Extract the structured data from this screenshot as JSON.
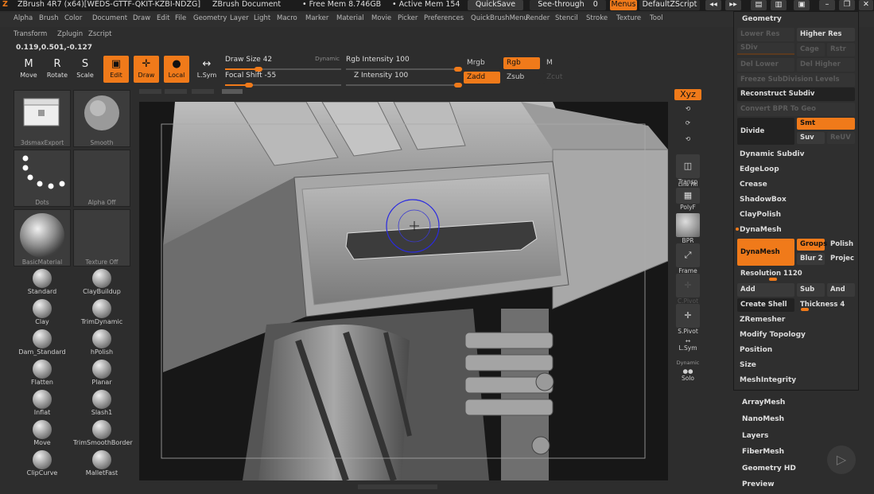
{
  "title_bar": {
    "app": "ZBrush 4R7 (x64)[WEDS-GTTF-QKIT-KZBI-NDZG]",
    "document": "ZBrush Document",
    "free_mem": "• Free Mem 8.746GB",
    "active_mem": "• Active Mem 154",
    "quicksave": "QuickSave",
    "see_through_label": "See-through",
    "see_through_value": "0",
    "menus": "Menus",
    "default_zscript": "DefaultZScript"
  },
  "menu_row1": [
    "Alpha",
    "Brush",
    "Color",
    "Document",
    "Draw",
    "Edit",
    "File",
    "Geometry",
    "Layer",
    "Light",
    "Macro",
    "Marker",
    "Material",
    "Movie",
    "Picker",
    "Preferences",
    "QuickBrushMenu",
    "Render",
    "Stencil",
    "Stroke",
    "Texture",
    "Tool"
  ],
  "menu_row2": [
    "Transform",
    "Zplugin",
    "Zscript"
  ],
  "coords": "0.119,0.501,-0.127",
  "tools": {
    "move": "Move",
    "rotate": "Rotate",
    "scale": "Scale",
    "edit": "Edit",
    "draw": "Draw",
    "local": "Local",
    "lsym": "L.Sym"
  },
  "sliders": {
    "draw_size_label": "Draw Size 42",
    "dynamic": "Dynamic",
    "focal_shift_label": "Focal Shift -55",
    "rgb_intensity_label": "Rgb Intensity 100",
    "z_intensity_label": "Z Intensity 100",
    "draw_size_fraction": 0.32,
    "focal_shift_fraction": 0.24,
    "rgb_intensity_fraction": 1.0,
    "z_intensity_fraction": 1.0
  },
  "color_modes": {
    "mrgb": "Mrgb",
    "rgb": "Rgb",
    "m": "M",
    "zadd": "Zadd",
    "zsub": "Zsub",
    "zcut": "Zcut"
  },
  "left_panel": {
    "thumbs": [
      "3dsmaxExport",
      "Smooth",
      "Dots",
      "Alpha Off",
      "BasicMaterial",
      "Texture Off"
    ],
    "brushes": [
      "Standard",
      "ClayBuildup",
      "Clay",
      "TrimDynamic",
      "Dam_Standard",
      "hPolish",
      "Flatten",
      "Planar",
      "Inflat",
      "Slash1",
      "Move",
      "TrimSmoothBorder",
      "ClipCurve",
      "MalletFast"
    ]
  },
  "right_strip": {
    "xyz": "Xyz",
    "transp": "Transp",
    "line_fill": "Line Fill",
    "polyf": "PolyF",
    "bpr": "BPR",
    "frame": "Frame",
    "cpivot": "C.Pivot",
    "spivot": "S.Pivot",
    "lsym": "L.Sym",
    "dynamic": "Dynamic",
    "solo": "Solo"
  },
  "geometry_panel": {
    "header": "Geometry",
    "lower_res": "Lower Res",
    "higher_res": "Higher Res",
    "sdiv": "SDiv",
    "cage": "Cage",
    "rstr": "Rstr",
    "del_lower": "Del Lower",
    "del_higher": "Del Higher",
    "freeze_subdivision": "Freeze SubDivision Levels",
    "reconstruct_subdiv": "Reconstruct Subdiv",
    "convert_bpr": "Convert BPR To Geo",
    "divide": "Divide",
    "smt": "Smt",
    "suv": "Suv",
    "reuv": "ReUV",
    "items": [
      "Dynamic Subdiv",
      "EdgeLoop",
      "Crease",
      "ShadowBox",
      "ClayPolish",
      "DynaMesh"
    ],
    "dynamesh_button": "DynaMesh",
    "groups": "Groups",
    "polish": "Polish",
    "blur": "Blur 2",
    "project": "Projec",
    "resolution_label": "Resolution 1120",
    "add": "Add",
    "sub": "Sub",
    "and": "And",
    "create_shell": "Create Shell",
    "thickness": "Thickness 4",
    "items2": [
      "ZRemesher",
      "Modify Topology",
      "Position",
      "Size",
      "MeshIntegrity"
    ]
  },
  "below_panel": [
    "ArrayMesh",
    "NanoMesh",
    "Layers",
    "FiberMesh",
    "Geometry HD",
    "Preview"
  ]
}
